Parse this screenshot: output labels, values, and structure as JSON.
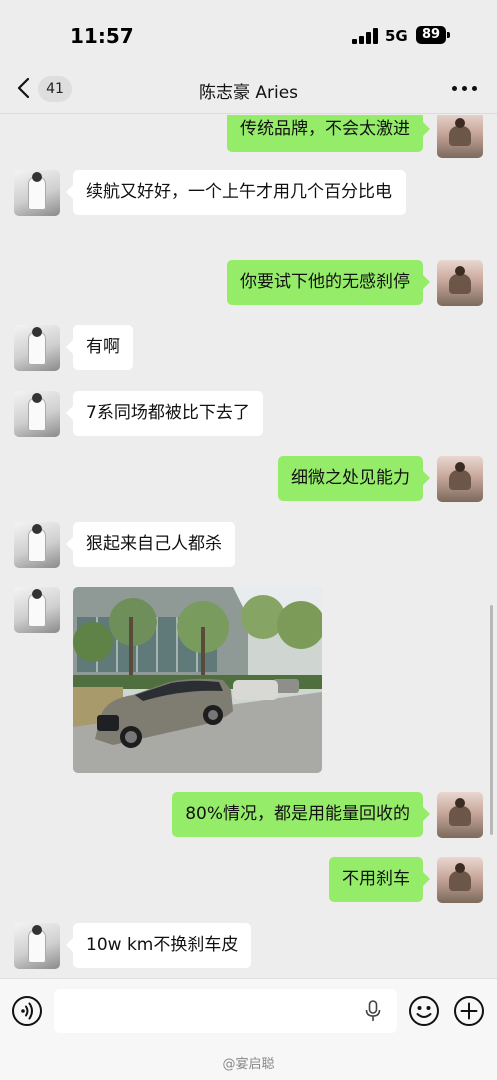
{
  "status_bar": {
    "time": "11:57",
    "network": "5G",
    "battery": "89"
  },
  "nav": {
    "back_count": "41",
    "title": "陈志豪 Aries"
  },
  "messages": [
    {
      "side": "out",
      "text": "传统品牌，不会太激进"
    },
    {
      "side": "in",
      "text": "续航又好好，一个上午才用几个百分比电"
    },
    {
      "side": "out",
      "text": "你要试下他的无感刹停"
    },
    {
      "side": "in",
      "text": "有啊"
    },
    {
      "side": "in",
      "text": "7系同场都被比下去了"
    },
    {
      "side": "out",
      "text": "细微之处见能力"
    },
    {
      "side": "in",
      "text": "狠起来自己人都杀"
    },
    {
      "side": "in",
      "type": "image",
      "image": "photo-bmw-7-series-parked"
    },
    {
      "side": "out",
      "text": "80%情况，都是用能量回收的"
    },
    {
      "side": "out",
      "text": "不用刹车"
    },
    {
      "side": "in",
      "text": "10w km不换刹车皮"
    }
  ],
  "input_bar": {
    "voice_icon": "voice-icon",
    "mic_icon": "mic-icon",
    "emoji_icon": "emoji-icon",
    "plus_icon": "plus-icon",
    "input_value": ""
  },
  "watermark": "@宴启聪",
  "colors": {
    "outgoing_bubble": "#95ec69",
    "incoming_bubble": "#ffffff",
    "background": "#ededed"
  }
}
